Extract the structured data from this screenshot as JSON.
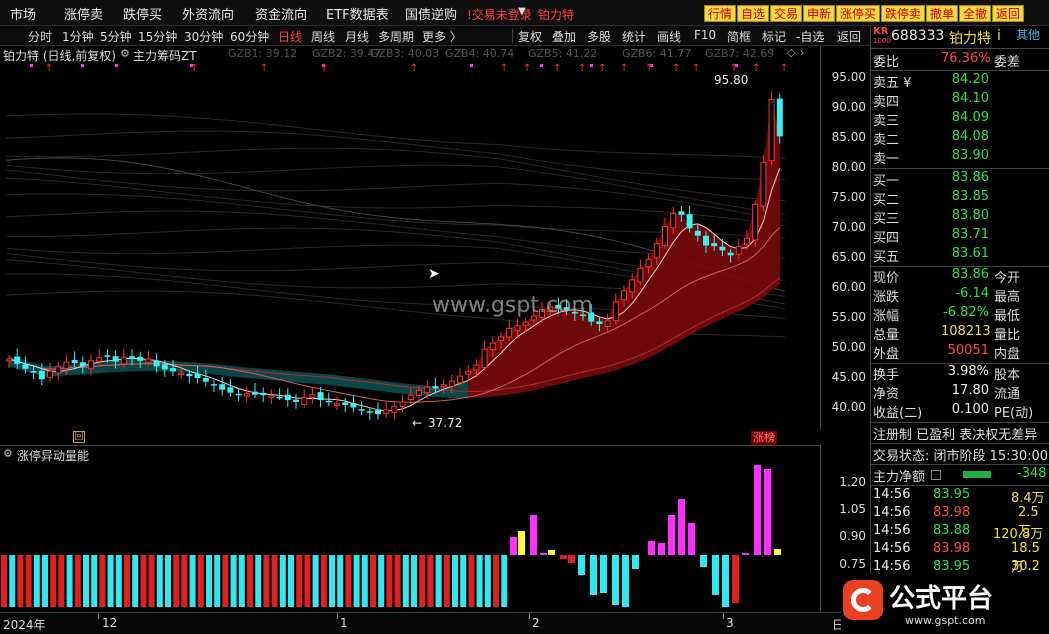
{
  "menu": [
    "市场",
    "涨停卖",
    "跌停买",
    "外资流向",
    "资金流向",
    "ETF数据表",
    "国债逆购"
  ],
  "alert_text": "!交易未登录",
  "alert_stock": "铂力特",
  "right_buttons": [
    "行情",
    "自选",
    "交易",
    "申新",
    "涨停买",
    "跌停卖",
    "撤单",
    "全撤",
    "返回"
  ],
  "periods": [
    "分时",
    "1分钟",
    "5分钟",
    "15分钟",
    "30分钟",
    "60分钟",
    "日线",
    "周线",
    "月线",
    "多周期",
    "更多 〉"
  ],
  "selected_period": "日线",
  "tools": [
    "复权",
    "叠加",
    "多股",
    "统计",
    "画线",
    "F10",
    "简框",
    "标记",
    "-自选",
    "返回"
  ],
  "title": "铂力特 (日线,前复权)",
  "indicator_main": "主力筹码ZT",
  "gzb": [
    "GZB1: 39.12",
    "GZB2: 39.47",
    "GZB3: 40.03",
    "GZB4: 40.74",
    "GZB5: 41.22",
    "GZB6: 41.77",
    "GZB7: 42.69"
  ],
  "y_ticks": [
    "95.00",
    "90.00",
    "85.00",
    "80.00",
    "75.00",
    "70.00",
    "65.00",
    "60.00",
    "55.00",
    "50.00",
    "45.00",
    "40.00"
  ],
  "high_label": "95.80",
  "low_label": "37.72",
  "watermark": "www.gspt.com",
  "zhangbang": "涨榜",
  "hui": "回",
  "ind2_title": "涨停异动量能",
  "ind2_ticks": [
    "1.20",
    "1.05",
    "0.90",
    "0.75"
  ],
  "dates": [
    "2024年",
    "12",
    "1",
    "2",
    "3",
    "日"
  ],
  "stock": {
    "prefix": "KR",
    "prefix2": "1000",
    "code": "688333",
    "name": "铂力特",
    "other": "其他"
  },
  "weibi": {
    "label": "委比",
    "value": "76.36%",
    "label2": "委差"
  },
  "asks": [
    {
      "label": "卖五 ¥",
      "price": "84.20"
    },
    {
      "label": "卖四",
      "price": "84.10"
    },
    {
      "label": "卖三",
      "price": "84.09"
    },
    {
      "label": "卖二",
      "price": "84.08"
    },
    {
      "label": "卖一",
      "price": "83.90"
    }
  ],
  "bids": [
    {
      "label": "买一",
      "price": "83.86"
    },
    {
      "label": "买二",
      "price": "83.85"
    },
    {
      "label": "买三",
      "price": "83.80"
    },
    {
      "label": "买四",
      "price": "83.71"
    },
    {
      "label": "买五",
      "price": "83.61"
    }
  ],
  "quote": [
    {
      "l": "现价",
      "v": "83.86",
      "c": "green",
      "l2": "今开"
    },
    {
      "l": "涨跌",
      "v": "-6.14",
      "c": "green",
      "l2": "最高"
    },
    {
      "l": "涨幅",
      "v": "-6.82%",
      "c": "green",
      "l2": "最低"
    },
    {
      "l": "总量",
      "v": "108213",
      "c": "yellow",
      "l2": "量比"
    },
    {
      "l": "外盘",
      "v": "50051",
      "c": "red",
      "l2": "内盘"
    },
    {
      "l": "换手",
      "v": "3.98%",
      "c": "white",
      "l2": "股本"
    },
    {
      "l": "净资",
      "v": "17.80",
      "c": "white",
      "l2": "流通"
    },
    {
      "l": "收益(二)",
      "v": "0.100",
      "c": "white",
      "l2": "PE(动)"
    }
  ],
  "tags": "注册制 已盈利 表决权无差异",
  "trade_status": "交易状态: 闭市阶段 15:30:00",
  "net_flow": {
    "label": "主力净额",
    "value": "-348"
  },
  "ticks": [
    {
      "t": "14:56",
      "p": "83.95",
      "v": "8.4万"
    },
    {
      "t": "14:56",
      "p": "83.98",
      "v": "2.5万"
    },
    {
      "t": "14:56",
      "p": "83.88",
      "v": "120.8万"
    },
    {
      "t": "14:56",
      "p": "83.98",
      "v": "18.5万"
    },
    {
      "t": "14:56",
      "p": "83.95",
      "v": "30.2万"
    }
  ],
  "logo": "公式平台",
  "logo_url": "www.gspt.com",
  "colors": {
    "up": "#ff3030",
    "down": "#40e8f0",
    "cyan": "#3cf0f0",
    "magenta": "#ff30ff",
    "yellow": "#ffff40"
  },
  "chart_data": {
    "type": "candlestick",
    "ylim": [
      37,
      97
    ],
    "close": [
      47.6,
      46.8,
      46.0,
      45.5,
      44.3,
      45.6,
      46.3,
      47.1,
      46.9,
      46.4,
      47.3,
      47.8,
      48.1,
      47.2,
      47.9,
      47.6,
      47.3,
      47.6,
      46.4,
      45.9,
      45.6,
      45.3,
      44.8,
      44.5,
      43.9,
      43.4,
      42.6,
      42.1,
      41.9,
      42.0,
      41.8,
      41.7,
      41.6,
      41.4,
      40.9,
      40.6,
      41.3,
      41.8,
      40.9,
      40.6,
      40.3,
      40.1,
      39.7,
      39.3,
      38.9,
      38.6,
      39.3,
      39.9,
      40.6,
      41.7,
      42.5,
      43.0,
      42.8,
      43.4,
      44.0,
      44.8,
      45.6,
      46.6,
      49.2,
      50.2,
      51.2,
      52.6,
      53.0,
      53.6,
      54.6,
      55.7,
      56.1,
      55.8,
      55.6,
      55.0,
      54.8,
      53.7,
      53.3,
      53.8,
      56.9,
      58.7,
      60.5,
      62.4,
      63.8,
      66.4,
      69.2,
      71.3,
      71.1,
      68.9,
      67.7,
      66.1,
      66.0,
      65.3,
      64.5,
      65.9,
      67.3,
      72.8,
      79.6,
      89.9,
      83.9
    ],
    "volume_bars": "red/cyan alternating",
    "price_annotations": {
      "high": 95.8,
      "low": 37.72
    }
  }
}
